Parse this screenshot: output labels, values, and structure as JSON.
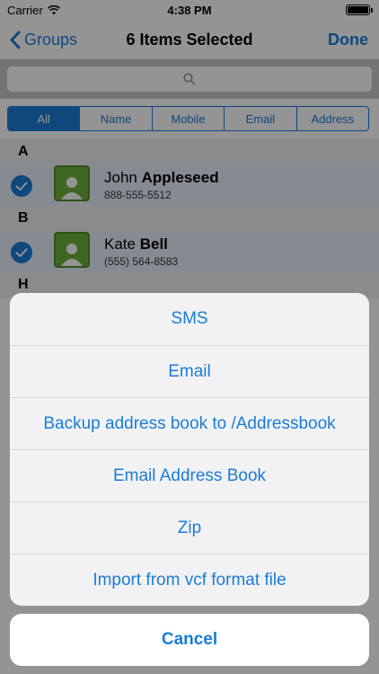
{
  "status_bar": {
    "carrier": "Carrier",
    "time": "4:38 PM"
  },
  "nav": {
    "back_label": "Groups",
    "title": "6 Items Selected",
    "done_label": "Done"
  },
  "search": {
    "placeholder": ""
  },
  "filters": {
    "tabs": [
      "All",
      "Name",
      "Mobile",
      "Email",
      "Address"
    ],
    "selected": "All"
  },
  "list": {
    "sections": [
      {
        "letter": "A",
        "contacts": [
          {
            "first": "John",
            "last": "Appleseed",
            "phone": "888-555-5512"
          }
        ]
      },
      {
        "letter": "B",
        "contacts": [
          {
            "first": "Kate",
            "last": "Bell",
            "phone": "(555) 564-8583"
          }
        ]
      },
      {
        "letter": "H",
        "contacts": []
      }
    ]
  },
  "action_sheet": {
    "items": [
      "SMS",
      "Email",
      "Backup address book to /Addressbook",
      "Email Address Book",
      "Zip",
      "Import from vcf format file"
    ],
    "cancel_label": "Cancel"
  },
  "colors": {
    "accent": "#1a7cd8",
    "avatar": "#6eb13a",
    "selected_row": "#e7f0fb"
  }
}
